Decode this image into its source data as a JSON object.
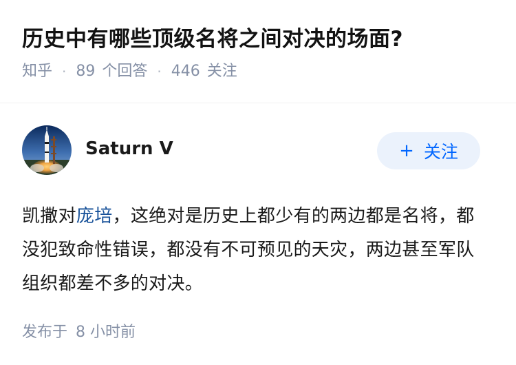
{
  "question": {
    "title": "历史中有哪些顶级名将之间对决的场面?",
    "source": "知乎",
    "answer_count": "89",
    "answer_label": "个回答",
    "follower_count": "446",
    "follower_label": "关注"
  },
  "answer": {
    "author": {
      "name": "Saturn V",
      "avatar_icon": "saturn-v-rocket-avatar"
    },
    "follow_button": {
      "icon": "+",
      "label": "关注"
    },
    "content": {
      "prefix": "凯撒对",
      "link_text": "庞培",
      "suffix": "，这绝对是历史上都少有的两边都是名将，都没犯致命性错误，都没有不可预见的天灾，两边甚至军队组织都差不多的对决。"
    },
    "published": {
      "label": "发布于",
      "value": "8 小时前"
    }
  },
  "colors": {
    "accent": "#0066ff",
    "link": "#175199",
    "meta": "#8590a6",
    "follow_bg": "#ebf2fc"
  }
}
